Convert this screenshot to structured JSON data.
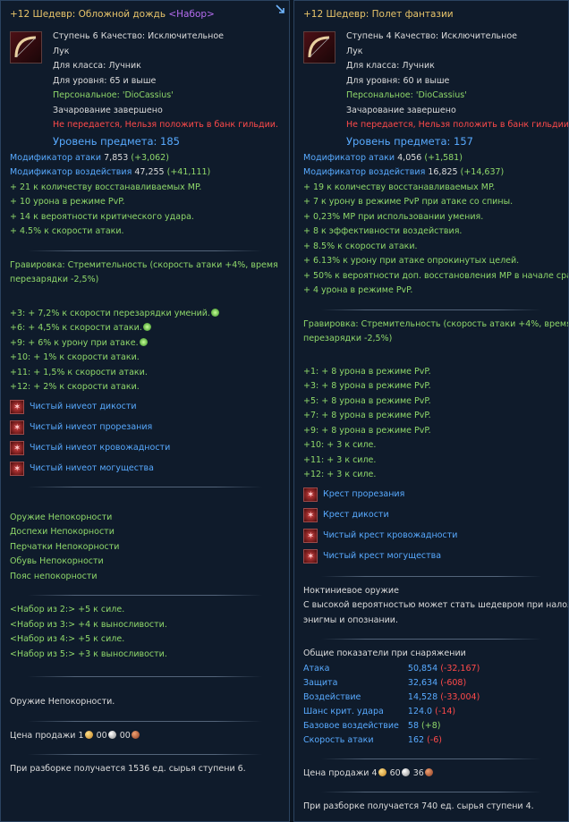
{
  "left": {
    "title_main": "+12 Шедевр: Обложной дождь",
    "title_set": "<Набор>",
    "icon": "bow-icon",
    "head": {
      "tier_quality": "Ступень 6 Качество: Исключительное",
      "type": "Лук",
      "class": "Для класса: Лучник",
      "level_req": "Для уровня: 65 и выше",
      "personal": "Персональное: 'DioCassius'",
      "enchant": "Зачарование завершено",
      "notrade": "Не передается, Нельзя положить в банк гильдии.",
      "item_level": "Уровень предмета: 185"
    },
    "mods": [
      {
        "label": "Модификатор атаки",
        "value": "7,853",
        "delta": "(+3,062)"
      },
      {
        "label": "Модификатор воздействия",
        "value": "47,255",
        "delta": "(+41,111)"
      }
    ],
    "bonuses": [
      "+ 21 к количеству восстанавливаемых MP.",
      "+ 10 урона в режиме PvP.",
      "+ 14 к вероятности критического удара.",
      "+ 4.5% к скорости атаки."
    ],
    "engraving": [
      "Гравировка: Стремительность (скорость атаки +4%, время",
      "перезарядки -2,5%)"
    ],
    "upgrade_bonuses": [
      {
        "text": "+3: + 7,2% к скорости перезарядки умений.",
        "icon": true
      },
      {
        "text": "+6: + 4,5% к скорости атаки.",
        "icon": true
      },
      {
        "text": "+9: + 6% к урону при атаке.",
        "icon": true
      },
      {
        "text": "+10: + 1% к скорости атаки.",
        "icon": false
      },
      {
        "text": "+11: + 1,5% к скорости атаки.",
        "icon": false
      },
      {
        "text": "+12: + 2% к скорости атаки.",
        "icon": false
      }
    ],
    "gems": [
      "Чистый ниveот дикости",
      "Чистый ниveот прорезания",
      "Чистый ниveот кровожадности",
      "Чистый ниveот могущества"
    ],
    "set_items": [
      "Оружие Непокорности",
      "Доспехи Непокорности",
      "Перчатки Непокорности",
      "Обувь Непокорности",
      "Пояс непокорности"
    ],
    "set_bonuses": [
      "<Набор из 2:> +5 к силе.",
      "<Набор из 3:> +4 к выносливости.",
      "<Набор из 4:> +5 к силе.",
      "<Набор из 5:> +3 к выносливости."
    ],
    "set_name": "Оружие Непокорности.",
    "price_label": "Цена продажи",
    "price": {
      "gold": "1",
      "silver": "00",
      "copper": "00"
    },
    "disassembly": "При разборке получается 1536 ед. сырья ступени 6."
  },
  "right": {
    "title_main": "+12 Шедевр: Полет фантазии",
    "icon": "bow-icon",
    "head": {
      "tier_quality": "Ступень 4 Качество: Исключительное",
      "type": "Лук",
      "class": "Для класса: Лучник",
      "level_req": "Для уровня: 60 и выше",
      "personal": "Персональное: 'DioCassius'",
      "enchant": "Зачарование завершено",
      "notrade": "Не передается, Нельзя положить в банк гильдии.",
      "item_level": "Уровень предмета: 157"
    },
    "mods": [
      {
        "label": "Модификатор атаки",
        "value": "4,056",
        "delta": "(+1,581)"
      },
      {
        "label": "Модификатор воздействия",
        "value": "16,825",
        "delta": "(+14,637)"
      }
    ],
    "bonuses": [
      "+ 19 к количеству восстанавливаемых MP.",
      "+ 7 к урону в режиме PvP при атаке со спины.",
      "+ 0,23% MP при использовании умения.",
      "+ 8 к эффективности воздействия.",
      "+ 8.5% к скорости атаки.",
      "+ 6.13% к урону при атаке опрокинутых целей.",
      "+ 50% к вероятности доп. восстановления MP в начале сражения.",
      "+ 4 урона в режиме PvP."
    ],
    "engraving": [
      "Гравировка: Стремительность (скорость атаки +4%, время",
      "перезарядки -2,5%)"
    ],
    "upgrade_bonuses": [
      "+1: + 8 урона в режиме PvP.",
      "+3: + 8 урона в режиме PvP.",
      "+5: + 8 урона в режиме PvP.",
      "+7: + 8 урона в режиме PvP.",
      "+9: + 8 урона в режиме PvP.",
      "+10: + 3 к силе.",
      "+11: + 3 к силе.",
      "+12: + 3 к силе."
    ],
    "gems": [
      "Крест прорезания",
      "Крест дикости",
      "Чистый крест кровожадности",
      "Чистый крест могущества"
    ],
    "nocturne_title": "Ноктиниевое оружие",
    "nocturne_desc": [
      "С высокой вероятностью может стать шедевром при наложении",
      "энигмы и опознании."
    ],
    "stats_title": "Общие показатели при снаряжении",
    "stats": [
      {
        "label": "Атака",
        "value": "50,854",
        "delta": "(-32,167)"
      },
      {
        "label": "Защита",
        "value": "32,634",
        "delta": "(-608)"
      },
      {
        "label": "Воздействие",
        "value": "14,528",
        "delta": "(-33,004)"
      },
      {
        "label": "Шанс крит. удара",
        "value": "124.0",
        "delta": "(-14)"
      },
      {
        "label": "Базовое воздействие",
        "value": "58",
        "delta": "(+8)"
      },
      {
        "label": "Скорость атаки",
        "value": "162",
        "delta": "(-6)"
      }
    ],
    "price_label": "Цена продажи",
    "price": {
      "gold": "4",
      "silver": "60",
      "copper": "36"
    },
    "disassembly": "При разборке получается 740 ед. сырья ступени 4."
  },
  "colors": {
    "title": "#e8c46a",
    "set_tag": "#b56cf0",
    "bonus_green": "#8fd86a",
    "stat_blue": "#58aaff",
    "warning_red": "#ff4a4a"
  }
}
